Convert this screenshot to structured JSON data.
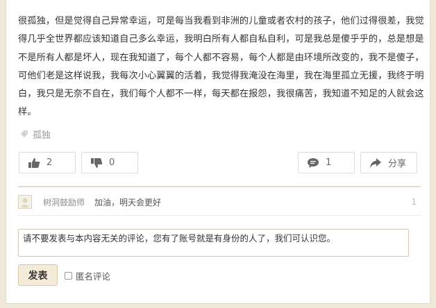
{
  "post": {
    "body": "很孤独，但是觉得自己异常幸运，可是每当我看到非洲的儿童或者农村的孩子，他们过得很差，我觉得几乎全世界都应该知道自己多么幸运，我明白所有人都自私自利，可是我总是傻乎乎的，总是想是不是所有人都是坏人，现在我知道了，每个人都不容易，每个人都是由环境所改变的，我不是傻子，可他们老是这样说我，我每次小心翼翼的活着，我觉得我淹没在海里，我在海里孤立无援，我终于明白，我只是无奈不自在，我们每个人都不一样，每天都在报怨，我很痛苦，我知道不知足的人就会这样。",
    "tag": "孤独"
  },
  "actions": {
    "like_count": "2",
    "dislike_count": "0",
    "comment_count": "1",
    "share_label": "分享"
  },
  "reply": {
    "user": "树洞鼓励师",
    "text": "加油，明天会更好",
    "count": "1"
  },
  "comment_form": {
    "value": "请不要发表与本内容无关的评论，您有了账号就是有身份的人了，我们可认识您。",
    "submit_label": "发表",
    "anonymous_label": "匿名评论"
  },
  "colors": {
    "background": "#efe7d7",
    "accent_divider": "#e6dcc5",
    "submit_bg": "#f4ecd8"
  }
}
